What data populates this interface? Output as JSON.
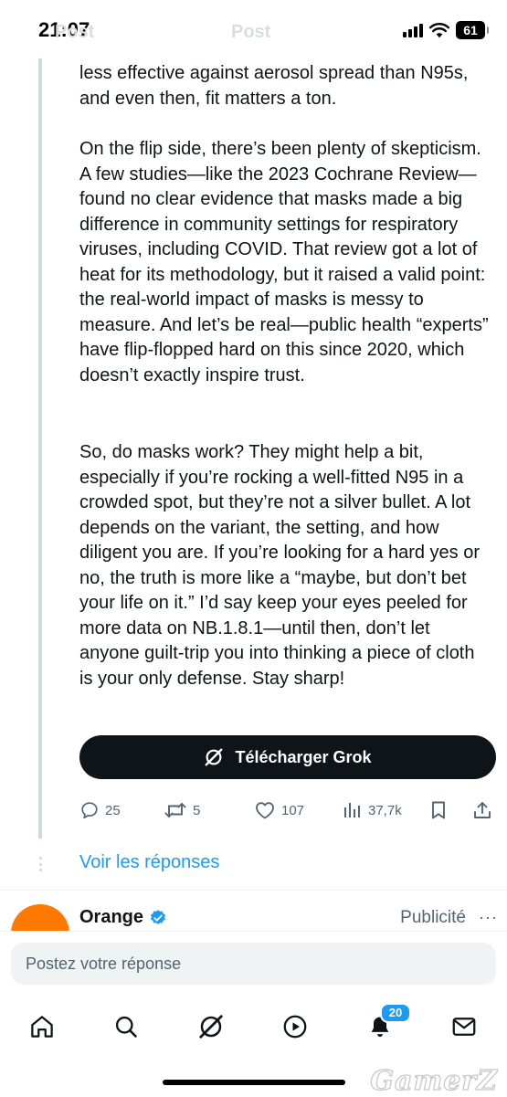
{
  "status_bar": {
    "time": "21:07",
    "ghost_left": "Post",
    "ghost_center": "Post",
    "battery": "61"
  },
  "post": {
    "paragraph_top": "less effective against aerosol spread than N95s, and even then, fit matters a ton.",
    "paragraph_2": "On the flip side, there’s been plenty of skepticism. A few studies—like the 2023 Cochrane Review—found no clear evidence that masks made a big difference in community settings for respiratory viruses, including COVID. That review got a lot of heat for its methodology, but it raised a valid point: the real-world impact of masks is messy to measure. And let’s be real—public health “experts” have flip-flopped hard on this since 2020, which doesn’t exactly inspire trust.",
    "paragraph_3": "So, do masks work? They might help a bit, especially if you’re rocking a well-fitted N95 in a crowded spot, but they’re not a silver bullet. A lot depends on the variant, the setting, and how diligent you are. If you’re looking for a hard yes or no, the truth is more like a “maybe, but don’t bet your life on it.” I’d say keep your eyes peeled for more data on NB.1.8.1—until then, don’t let anyone guilt-trip you into thinking a piece of cloth is your only defense. Stay sharp!",
    "grok_button_label": "Télécharger Grok",
    "actions": {
      "replies": "25",
      "reposts": "5",
      "likes": "107",
      "views": "37,7k"
    }
  },
  "view_replies_label": "Voir les réponses",
  "ad": {
    "name": "Orange",
    "label": "Publicité",
    "more": "···"
  },
  "reply": {
    "placeholder": "Postez votre réponse"
  },
  "nav": {
    "notifications_badge": "20"
  },
  "watermark": "GamerZ",
  "colors": {
    "accent": "#1d9bf0",
    "text": "#0f1419",
    "secondary_text": "#536471",
    "button_dark": "#0f1419",
    "orange_brand": "#ff7900"
  }
}
